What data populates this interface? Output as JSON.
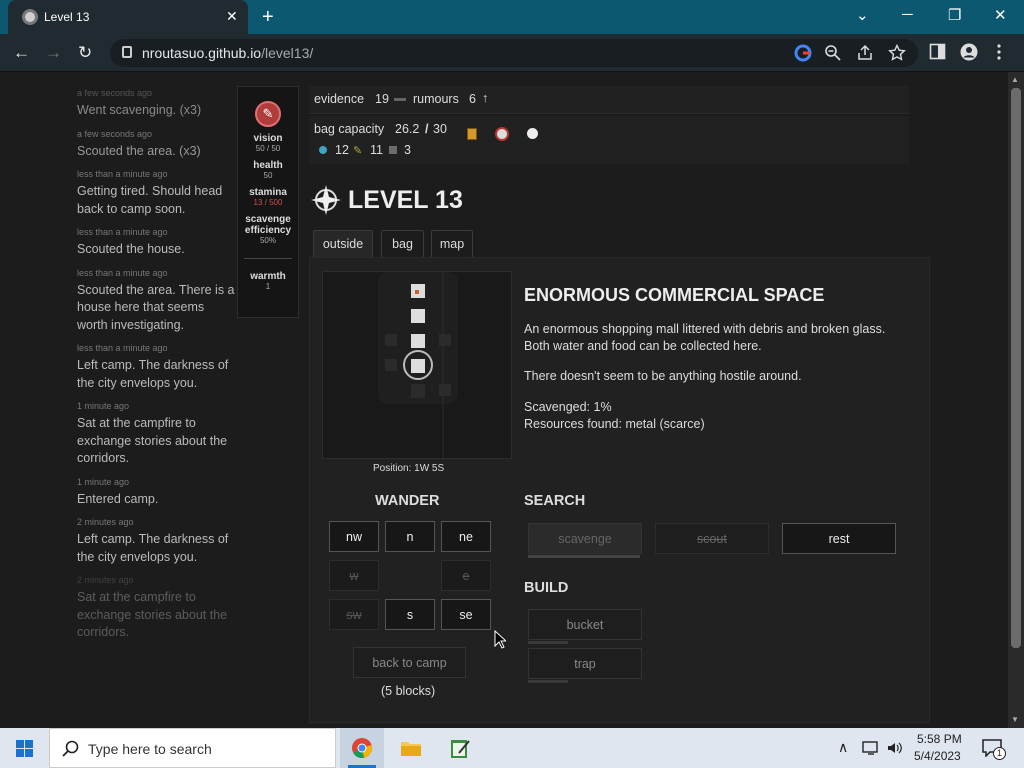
{
  "browser": {
    "tab_title": "Level 13",
    "new_tab": "+",
    "url_host": "nroutasuo.github.io",
    "url_path": "/level13/",
    "min": "─",
    "restore": "❐",
    "close": "✕",
    "dropdown": "⌄",
    "back": "←",
    "forward": "→",
    "reload": "↻"
  },
  "log": [
    {
      "time": "a few seconds ago",
      "text": "Went scavenging. (x3)"
    },
    {
      "time": "a few seconds ago",
      "text": "Scouted the area. (x3)"
    },
    {
      "time": "less than a minute ago",
      "text": "Getting tired. Should head back to camp soon."
    },
    {
      "time": "less than a minute ago",
      "text": "Scouted the house."
    },
    {
      "time": "less than a minute ago",
      "text": "Scouted the area. There is a house here that seems worth investigating."
    },
    {
      "time": "less than a minute ago",
      "text": "Left camp. The darkness of the city envelops you."
    },
    {
      "time": "1 minute ago",
      "text": "Sat at the campfire to exchange stories about the corridors."
    },
    {
      "time": "1 minute ago",
      "text": "Entered camp."
    },
    {
      "time": "2 minutes ago",
      "text": "Left camp. The darkness of the city envelops you."
    },
    {
      "time": "2 minutes ago",
      "text": "Sat at the campfire to exchange stories about the corridors."
    }
  ],
  "stats": {
    "vision_label": "vision",
    "vision_value": "50 / 50",
    "health_label": "health",
    "health_value": "50",
    "stamina_label": "stamina",
    "stamina_value": "13 / 500",
    "scavenge_label": "scavenge efficiency",
    "scavenge_value": "50%",
    "warmth_label": "warmth",
    "warmth_value": "1"
  },
  "top": {
    "evidence_label": "evidence",
    "evidence_value": "19",
    "rumours_label": "rumours",
    "rumours_value": "6",
    "bag_label": "bag capacity",
    "bag_value": "26.2",
    "bag_sep": "/",
    "bag_max": "30",
    "res1": "12",
    "res2": "11",
    "res3": "3"
  },
  "level": {
    "title": "LEVEL 13"
  },
  "tabs": [
    "outside",
    "bag",
    "map"
  ],
  "location": {
    "title": "ENORMOUS COMMERCIAL SPACE",
    "desc": "An enormous shopping mall littered with debris and broken glass. Both water and food can be collected here.",
    "hostile": "There doesn't seem to be anything hostile around.",
    "scavenged": "Scavenged: 1%",
    "resources": "Resources found: metal (scarce)"
  },
  "position": "Position: 1W 5S",
  "wander": {
    "title": "WANDER",
    "nw": "nw",
    "n": "n",
    "ne": "ne",
    "w": "w",
    "e": "e",
    "sw": "sw",
    "s": "s",
    "se": "se",
    "back": "back to camp",
    "blocks": "(5 blocks)"
  },
  "search": {
    "title": "SEARCH",
    "scavenge": "scavenge",
    "scout": "scout",
    "rest": "rest"
  },
  "build": {
    "title": "BUILD",
    "bucket": "bucket",
    "trap": "trap"
  },
  "taskbar": {
    "search_placeholder": "Type here to search",
    "time": "5:58 PM",
    "date": "5/4/2023",
    "notif": "1"
  },
  "colors": {
    "bg": "#1b1c1b",
    "panel": "#202120",
    "tab_bar": "#0c5870",
    "taskbar": "#dfe6ef"
  }
}
